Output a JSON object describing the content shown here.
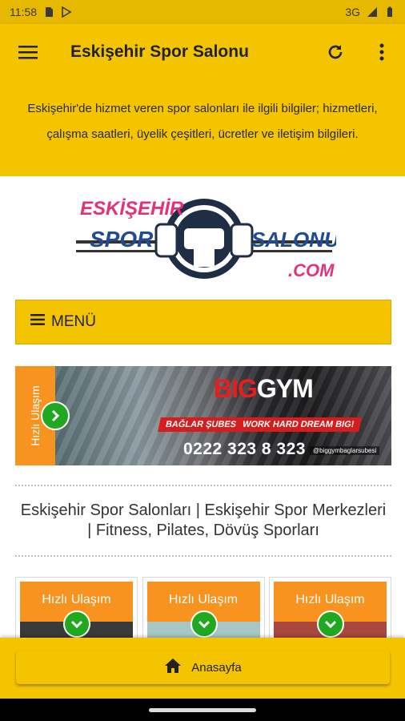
{
  "status_bar": {
    "time": "11:58",
    "network": "3G",
    "icons": [
      "sim-card-icon",
      "play-store-icon",
      "signal-icon",
      "battery-icon"
    ]
  },
  "app_bar": {
    "title": "Eskişehir Spor Salonu",
    "icons": [
      "menu-icon",
      "refresh-icon",
      "more-vert-icon"
    ]
  },
  "intro": {
    "text": "Eskişehir'de hizmet veren spor salonları ile ilgili bilgiler; hizmetleri, çalışma saatleri, üyelik çeşitleri, ücretler ve iletişim bilgileri."
  },
  "logo": {
    "line1": "ESKİŞEHİR",
    "line2_left": "SPOR",
    "line2_right": "SALONU",
    "line3": ".COM"
  },
  "menu": {
    "label": "MENÜ"
  },
  "banner": {
    "side_label": "Hızlı Ulaşım",
    "brand_red": "BIG",
    "brand_white": "GYM",
    "tag_branch": "BAĞLAR ŞUBESİ",
    "tag_slogan": "WORK HARD DREAM BIG!",
    "phone": "0222 323 8 323",
    "handle": "@biggymbaglarsubesi"
  },
  "section": {
    "title": "Eskişehir Spor Salonları | Eskişehir Spor Merkezleri | Fitness, Pilates, Dövüş Sporları"
  },
  "cards": [
    {
      "label": "Hızlı Ulaşım",
      "color": "#3a3a3a"
    },
    {
      "label": "Hızlı Ulaşım",
      "color": "#a7c7c5"
    },
    {
      "label": "Hızlı Ulaşım",
      "color": "#a8483f"
    }
  ],
  "bottom_bar": {
    "home_label": "Anasayfa"
  },
  "colors": {
    "primary": "#f4c400",
    "status_bar": "#e6b800",
    "accent_orange": "#f7931e",
    "go_green": "#20a820"
  }
}
